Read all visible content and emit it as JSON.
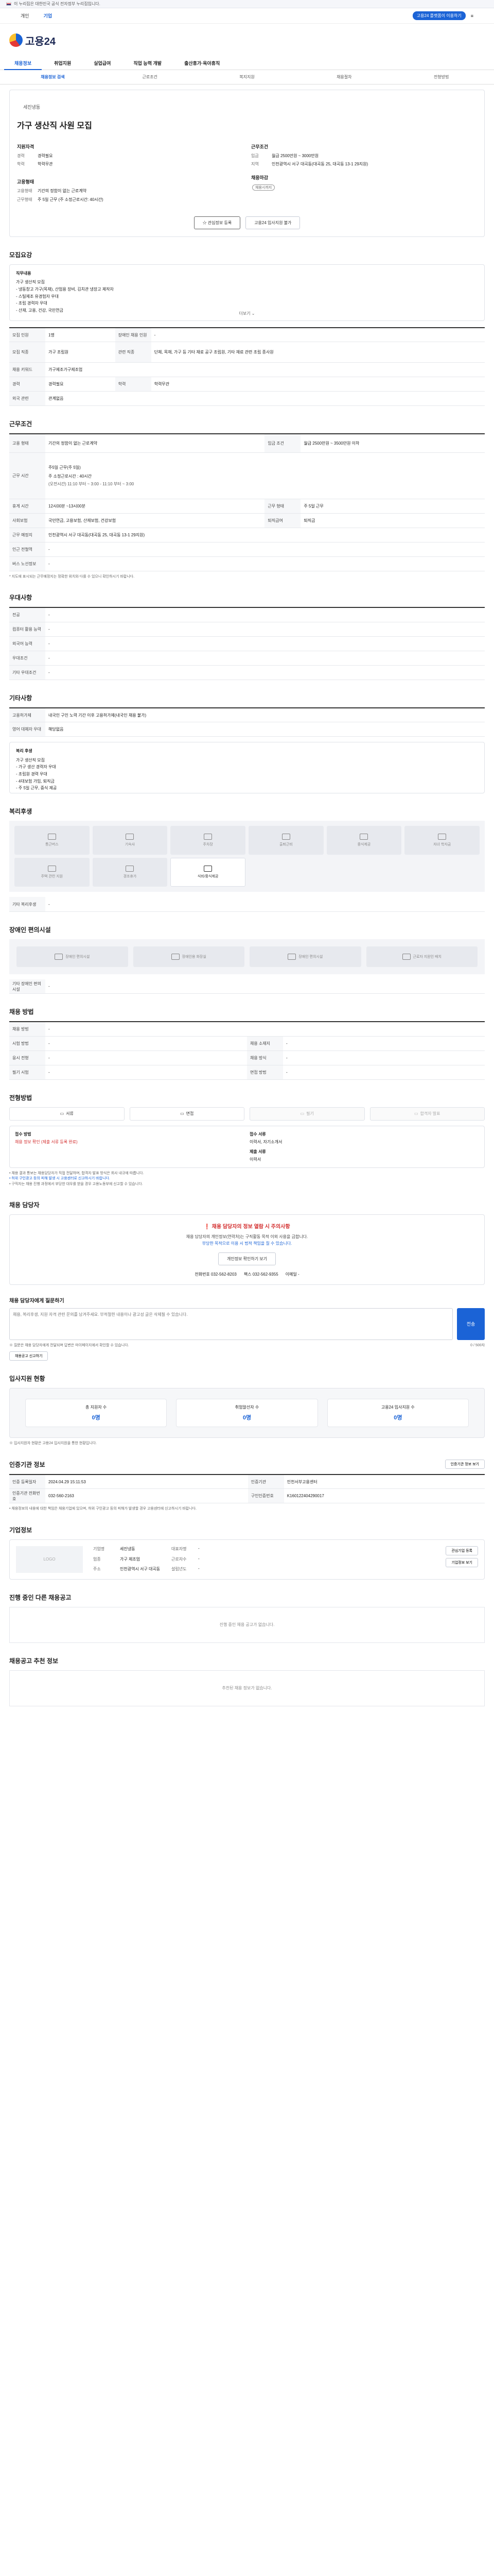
{
  "notice": "이 누리집은 대한민국 공식 전자정부 누리집입니다.",
  "topbar": {
    "tab1": "개인",
    "tab2": "기업",
    "pill": "고용24 플랫폼이 이용하기",
    "menu": "≡"
  },
  "logo": "고용24",
  "gnb": [
    "채용정보",
    "취업지원",
    "실업급여",
    "직업 능력 개발",
    "출산휴가·육아휴직"
  ],
  "lnb": [
    "채용정보 검색",
    "근로조건",
    "복지지원",
    "채용절차",
    "전형방법"
  ],
  "summary": {
    "company": "세진냉동",
    "title": "가구 생산직 사원 모집",
    "left_head": "지원자격",
    "left": [
      {
        "k": "경력",
        "v": "경력필요"
      },
      {
        "k": "학력",
        "v": "학력무관"
      }
    ],
    "right_head": "근무조건",
    "right": [
      {
        "k": "임금",
        "v": "월급 2500만원 ~ 3000만원"
      },
      {
        "k": "지역",
        "v": "인천광역시 서구 대곡동(대곡동 25, 대곡동 13-1 29지원)"
      }
    ],
    "left2_head": "고용형태",
    "left2": [
      {
        "k": "고용형태",
        "v": "기간의 정함이 없는 근로계약"
      },
      {
        "k": "근무형태",
        "v": "주 5일 근무 (주 소정근로시간: 40시간)"
      }
    ],
    "right2_head": "채용마감",
    "right2_badge": "채용시까지",
    "btn_main": "관심정보 등록",
    "btn_sub": "고용24 입사지원 불가"
  },
  "duty": {
    "title": "모집요강",
    "head": "직무내용",
    "lines": [
      "가구 생산직 모집",
      "- 냉동창고 가구(목재), 산업용 장비, 김치관 냉장고 제작자",
      "- 스틸제조 유경험자 우대",
      "- 조립 경력자 우대",
      "- 산재, 고용, 건강, 국민연금",
      "- 4대보험 가입, 퇴직금",
      "- 근무시간: 08:00-17:00",
      "- 중식 제공(구내식당)"
    ],
    "more": "더보기 ⌄"
  },
  "recruit": [
    {
      "k": "모집 인원",
      "v": "1명",
      "k2": "장애인 채용 인원",
      "v2": "-"
    },
    {
      "k": "모집 직종",
      "v": "가구 조립원",
      "k2": "관련 직종",
      "v2": "단체, 목재, 가구 등 기타 재료 공구 조립원, 기타 재료 관련 조립 종사원"
    },
    {
      "k": "채용 키워드",
      "v": "가구제조가구제조업",
      "k2": "",
      "v2": ""
    },
    {
      "k": "경력",
      "v": "경력필요",
      "k2": "학력",
      "v2": "학력무관"
    },
    {
      "k": "외국 관련",
      "v": "관계없음",
      "k2": "",
      "v2": ""
    }
  ],
  "work": {
    "title": "근무조건",
    "rows": [
      {
        "k": "고용 형태",
        "v": "기간의 정함이 없는 근로계약",
        "k2": "임금 조건",
        "v2": "월급 2500만원 ~ 3500만원 이하"
      },
      {
        "k": "근무 시간",
        "v": "주 소정근로시간 : 40시간",
        "k2": "",
        "v2": ""
      },
      {
        "k": "근무 형태",
        "v": "주5일 근무(주 5일)",
        "k2": "",
        "v2": ""
      },
      {
        "k": "휴게 시간",
        "v": "12시00분 ~13시00분",
        "k2": "근무 형태",
        "v2": "주 5일 근무"
      },
      {
        "k": "사회보험",
        "v": "국민연금, 고용보험, 산재보험, 건강보험",
        "k2": "퇴직급여",
        "v2": "퇴직금"
      },
      {
        "k": "근무 예정지",
        "v": "인천광역시 서구 대곡동(대곡동 25, 대곡동 13-1 29지원)",
        "k2": "",
        "v2": ""
      },
      {
        "k": "인근 전철역",
        "v": "-",
        "k2": "",
        "v2": ""
      },
      {
        "k": "버스 노선정보",
        "v": "-",
        "k2": "",
        "v2": ""
      }
    ],
    "time_detail": "(오전시간) 11:10 부터 ~ 3:00 - 11:10 부터 ~ 3:00",
    "note": "* 지도에 표시되는 근무예정지는 정확한 위치와 다를 수 있으니 확인하시기 바랍니다."
  },
  "qual": {
    "title": "우대사항",
    "rows": [
      {
        "k": "전공",
        "v": "-"
      },
      {
        "k": "컴퓨터 활용 능력",
        "v": "-"
      },
      {
        "k": "외국어 능력",
        "v": "-"
      },
      {
        "k": "우대조건",
        "v": "-"
      },
      {
        "k": "기타 우대조건",
        "v": "-"
      }
    ]
  },
  "etc": {
    "title": "기타사항",
    "rows": [
      {
        "k": "고용허가제",
        "v": "내국인 구인 노력 기간 이후 고용허가제(내국인 채용 불가)"
      },
      {
        "k": "영어 대체자 우대",
        "v": "해당없음"
      }
    ],
    "detail_head": "복리 후생",
    "detail": [
      "가구 생산직 모집",
      "- 가구 생산 경력자 우대",
      "- 조립원 경력 우대",
      "- 4대보험 가입, 퇴직금",
      "- 주 5일 근무, 중식 제공"
    ]
  },
  "welfare": {
    "title": "복리후생",
    "items": [
      "통근버스",
      "기숙사",
      "주차장",
      "출퇴근비",
      "중식제공",
      "자녀 학자금",
      "주택 관련 지원",
      "경조휴가",
      "식비/중식제공"
    ],
    "etc_label": "기타 복리후생",
    "etc_value": "-"
  },
  "disab": {
    "title": "장애인 편의시설",
    "items": [
      "장애인 편의시설",
      "장애인용 화장실",
      "장애인 편의시설",
      "근로자 지원인 배치"
    ],
    "etc_label": "기타 장애인 편의시설",
    "etc_value": "-"
  },
  "method": {
    "title": "채용 방법",
    "rows": [
      {
        "k": "채용 방법",
        "v": "-",
        "k2": "",
        "v2": ""
      },
      {
        "k": "시험 방법",
        "v": "-",
        "k2": "채용 소재지",
        "v2": "-"
      },
      {
        "k": "응시 전형",
        "v": "-",
        "k2": "채용 방식",
        "v2": "-"
      },
      {
        "k": "필기 시험",
        "v": "-",
        "k2": "면접 방법",
        "v2": "-"
      }
    ]
  },
  "procedure": {
    "title": "전형방법",
    "tabs": [
      "서류",
      "면접",
      "필기",
      "합격자 발표"
    ],
    "doc_label": "접수 방법",
    "doc_value": "채용 정보 확인 (제출 서류 등록 완료)",
    "apply_label": "접수 서류",
    "apply_value": "이력서, 자기소개서",
    "req_label": "제출 서류",
    "req_value": "이력서",
    "notes": [
      "• 채용 결과 통보는 채용담당자가 직접 전달하며, 합격자 발표 방식은 회사 내규에 따릅니다.",
      "• 허위 구인광고 등의 피해 발생 시 고용센터로 신고하시기 바랍니다.",
      "• 구직자는 채용 진행 과정에서 부당한 대우를 받을 경우 고용노동부에 신고할 수 있습니다."
    ]
  },
  "manager": {
    "title": "채용 담당자",
    "warn_title": "채용 담당자의 정보 열람 시 주의사항",
    "warn_desc1": "채용 담당자의 개인정보(연락처)는 구직활동 목적 이외 사용을 금합니다.",
    "warn_desc2": "부당한 목적으로 이용 시 법적 책임을 질 수 있습니다.",
    "btn": "개인정보 확인하기 보기",
    "tel_label": "전화번호",
    "tel": "032-562-8203",
    "fax_label": "팩스",
    "fax": "032-562-9355",
    "mail_label": "이메일",
    "mail": "-"
  },
  "qna": {
    "title": "채용 담당자에게 질문하기",
    "placeholder": "채용, 복리후생, 지원 자격 관련 문의를 남겨주세요. 부적절한 내용이나 광고성 글은 삭제될 수 있습니다.",
    "count": "0 / 500자",
    "send": "전송",
    "note": "※ 질문은 채용 담당자에게 전달되며 답변은 마이페이지에서 확인할 수 있습니다.",
    "note_btn": "채용공고 신고하기"
  },
  "apply_status": {
    "title": "입사지원 현황",
    "items": [
      {
        "label": "총 지원자 수",
        "value": "0명"
      },
      {
        "label": "취업알선자 수",
        "value": "0명"
      },
      {
        "label": "고용24 입사지원 수",
        "value": "0명"
      }
    ],
    "note": "※ 입사지원자 현황은 고용24 입사지원을 통한 현황입니다."
  },
  "org": {
    "title": "인증기관 정보",
    "btn": "인증기관 정보 보기",
    "rows": [
      {
        "k": "인증 등록일자",
        "v": "2024.04.29 15:11:53",
        "k2": "인증기관",
        "v2": "인천서부고용센터"
      },
      {
        "k": "인증기관 전화번호",
        "v": "032-560-2163",
        "k2": "구인인증번호",
        "v2": "K160122404290017"
      }
    ],
    "note": "• 채용정보의 내용에 대한 책임은 채용기업에 있으며, 허위 구인광고 등의 피해가 발생할 경우 고용센터에 신고하시기 바랍니다."
  },
  "company": {
    "title": "기업정보",
    "logo": "LOGO",
    "fields": [
      {
        "k": "기업명",
        "v": "세진냉동"
      },
      {
        "k": "대표자명",
        "v": "-"
      },
      {
        "k": "업종",
        "v": "가구 제조업"
      },
      {
        "k": "근로자수",
        "v": "-"
      },
      {
        "k": "주소",
        "v": "인천광역시 서구 대곡동"
      },
      {
        "k": "설립년도",
        "v": "-"
      }
    ],
    "btn1": "관심기업 등록",
    "btn2": "기업정보 보기"
  },
  "other_jobs": {
    "title": "진행 중인 다른 채용공고",
    "empty": "진행 중인 채용 공고가 없습니다."
  },
  "recommend": {
    "title": "채용공고 추천 정보",
    "empty": "추천된 채용 정보가 없습니다."
  }
}
